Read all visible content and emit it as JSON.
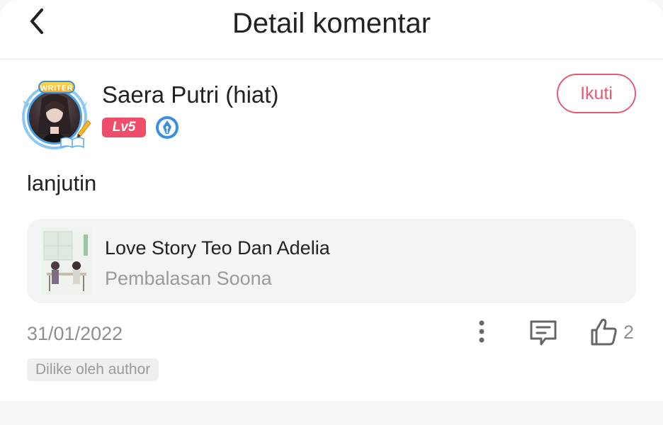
{
  "header": {
    "title": "Detail komentar",
    "back_icon": "chevron-left-icon"
  },
  "user": {
    "name": "Saera Putri (hiat)",
    "level": "Lv5",
    "avatar_frame_badge": "WRITER",
    "writer_icon": "pen-nib-icon",
    "follow_label": "Ikuti"
  },
  "comment": {
    "text": "lanjutin",
    "date": "31/01/2022",
    "like_count": "2",
    "author_tag": "Dilike oleh author"
  },
  "book": {
    "title": "Love Story Teo Dan Adelia",
    "chapter": "Pembalasan Soona"
  },
  "colors": {
    "accent": "#e85a74",
    "level_badge": "#ef4e6a",
    "writer_blue": "#3a8fe0",
    "muted_text": "#8f8f8f"
  }
}
